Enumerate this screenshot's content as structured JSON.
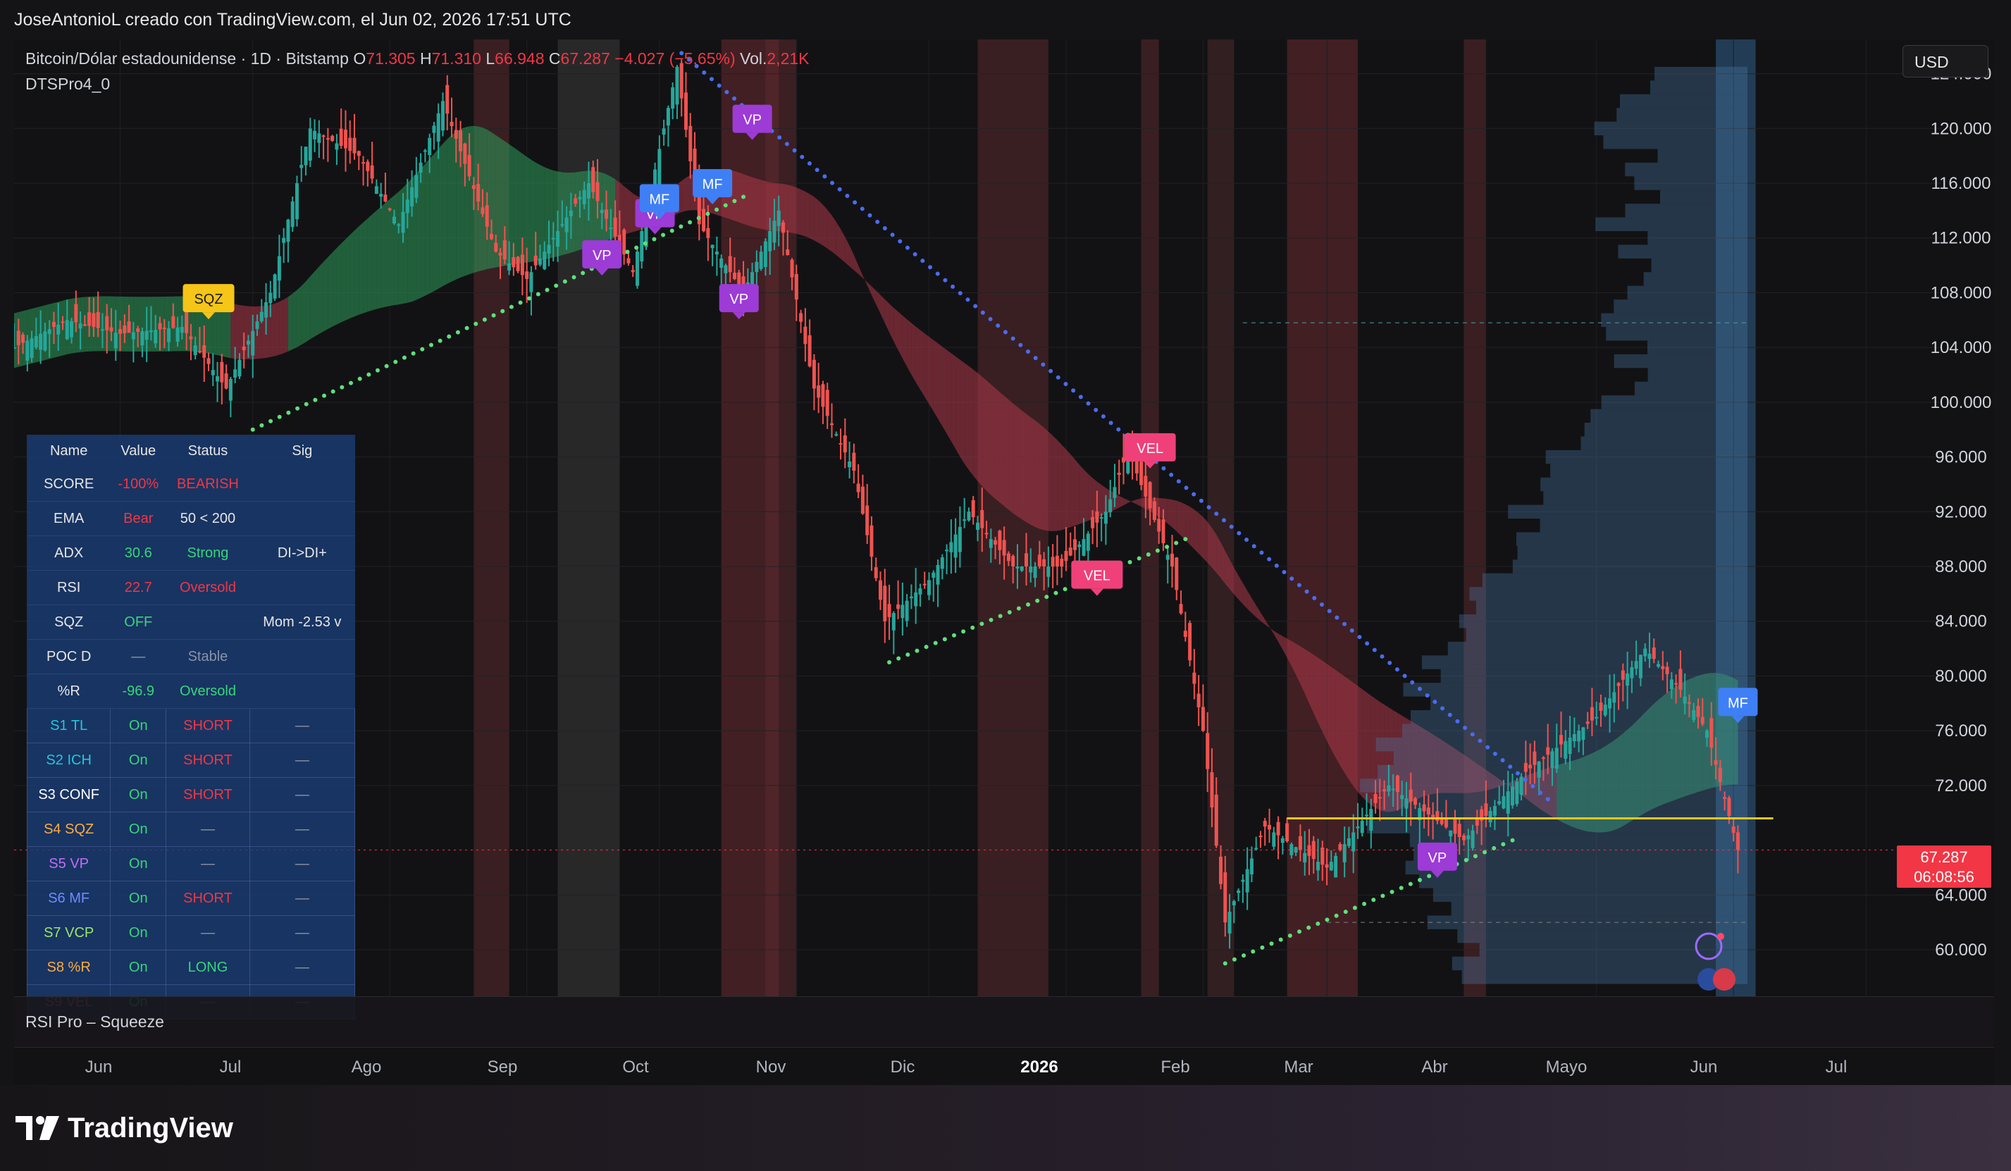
{
  "header": {
    "caption": "JoseAntonioL creado con TradingView.com, el Jun 02, 2026 17:51 UTC"
  },
  "legend": {
    "symbol": "Bitcoin/Dólar estadounidense · 1D · Bitstamp",
    "o_label": "O",
    "o_value": "71.305",
    "h_label": "H",
    "h_value": "71.310",
    "l_label": "L",
    "l_value": "66.948",
    "c_label": "C",
    "c_value": "67.287",
    "change": "−4.027 (−5,65%)",
    "vol_label": "Vol.",
    "vol_value": "2,21K",
    "indicator": "DTSPro4_0"
  },
  "currency_button": "USD",
  "price_tag": {
    "price": "67.287",
    "countdown": "06:08:56"
  },
  "rsi_pane": {
    "label": "RSI Pro – Squeeze"
  },
  "colors": {
    "bull": "#26a69a",
    "bear": "#ef5350",
    "background": "#121214",
    "cloud_bull": "#2e9e5b",
    "cloud_bear": "#b0384a",
    "vp": "#9c3bd6",
    "mf": "#3f7ff5",
    "vel": "#f0407a",
    "sqz": "#f5c518"
  },
  "brand": {
    "name": "TradingView"
  },
  "signal_table": {
    "headers": [
      "Name",
      "Value",
      "Status",
      "Sig"
    ],
    "rows": [
      {
        "name": "SCORE",
        "value": "-100%",
        "status": "BEARISH",
        "sig": ""
      },
      {
        "name": "EMA",
        "value": "Bear",
        "status": "50 < 200",
        "sig": ""
      },
      {
        "name": "ADX",
        "value": "30.6",
        "status": "Strong",
        "sig": "DI->DI+"
      },
      {
        "name": "RSI",
        "value": "22.7",
        "status": "Oversold",
        "sig": ""
      },
      {
        "name": "SQZ",
        "value": "OFF",
        "status": "",
        "sig": "Mom -2.53 v"
      },
      {
        "name": "POC D",
        "value": "—",
        "status": "Stable",
        "sig": ""
      },
      {
        "name": "%R",
        "value": "-96.9",
        "status": "Oversold",
        "sig": ""
      }
    ],
    "strategies": [
      {
        "name": "S1 TL",
        "value": "On",
        "status": "SHORT",
        "sig": "—"
      },
      {
        "name": "S2 ICH",
        "value": "On",
        "status": "SHORT",
        "sig": "—"
      },
      {
        "name": "S3 CONF",
        "value": "On",
        "status": "SHORT",
        "sig": "—"
      },
      {
        "name": "S4 SQZ",
        "value": "On",
        "status": "—",
        "sig": "—"
      },
      {
        "name": "S5 VP",
        "value": "On",
        "status": "—",
        "sig": "—"
      },
      {
        "name": "S6 MF",
        "value": "On",
        "status": "SHORT",
        "sig": "—"
      },
      {
        "name": "S7 VCP",
        "value": "On",
        "status": "—",
        "sig": "—"
      },
      {
        "name": "S8 %R",
        "value": "On",
        "status": "LONG",
        "sig": "—"
      },
      {
        "name": "S9 VEL",
        "value": "On",
        "status": "—",
        "sig": "—"
      }
    ]
  },
  "chart_data": {
    "type": "candlestick",
    "title": "Bitcoin/Dólar estadounidense · 1D · Bitstamp",
    "y_ticks": [
      "124.000",
      "120.000",
      "116.000",
      "112.000",
      "108.000",
      "104.000",
      "100.000",
      "96.000",
      "92.000",
      "88.000",
      "84.000",
      "80.000",
      "76.000",
      "72.000",
      "64.000",
      "60.000"
    ],
    "y_tick_values": [
      124000,
      120000,
      116000,
      112000,
      108000,
      104000,
      100000,
      96000,
      92000,
      88000,
      84000,
      80000,
      76000,
      72000,
      64000,
      60000
    ],
    "ylim": [
      56500,
      126500
    ],
    "x_ticks": [
      {
        "label": "Jun",
        "date": "2025-06-01"
      },
      {
        "label": "Jul",
        "date": "2025-07-01"
      },
      {
        "label": "Ago",
        "date": "2025-08-01"
      },
      {
        "label": "Sep",
        "date": "2025-09-01"
      },
      {
        "label": "Oct",
        "date": "2025-10-01"
      },
      {
        "label": "Nov",
        "date": "2025-11-01"
      },
      {
        "label": "Dic",
        "date": "2025-12-01"
      },
      {
        "label": "2026",
        "date": "2026-01-01"
      },
      {
        "label": "Feb",
        "date": "2026-02-01"
      },
      {
        "label": "Mar",
        "date": "2026-03-01"
      },
      {
        "label": "Abr",
        "date": "2026-04-01"
      },
      {
        "label": "Mayo",
        "date": "2026-05-01"
      },
      {
        "label": "Jun",
        "date": "2026-06-01"
      },
      {
        "label": "Jul",
        "date": "2026-07-01"
      }
    ],
    "xlim": [
      "2025-05-08",
      "2026-07-18"
    ],
    "close_series": [
      [
        "2025-05-08",
        104000
      ],
      [
        "2025-05-20",
        106000
      ],
      [
        "2025-06-01",
        105000
      ],
      [
        "2025-06-15",
        105500
      ],
      [
        "2025-06-25",
        101000
      ],
      [
        "2025-07-05",
        108000
      ],
      [
        "2025-07-14",
        120000
      ],
      [
        "2025-07-25",
        118000
      ],
      [
        "2025-08-03",
        113000
      ],
      [
        "2025-08-13",
        122000
      ],
      [
        "2025-08-25",
        111000
      ],
      [
        "2025-09-01",
        109000
      ],
      [
        "2025-09-15",
        116000
      ],
      [
        "2025-09-25",
        109500
      ],
      [
        "2025-10-05",
        124500
      ],
      [
        "2025-10-10",
        113000
      ],
      [
        "2025-10-20",
        108000
      ],
      [
        "2025-10-28",
        114000
      ],
      [
        "2025-11-05",
        101000
      ],
      [
        "2025-11-14",
        95000
      ],
      [
        "2025-11-21",
        84000
      ],
      [
        "2025-12-01",
        87000
      ],
      [
        "2025-12-10",
        92000
      ],
      [
        "2025-12-20",
        88000
      ],
      [
        "2025-12-31",
        88000
      ],
      [
        "2026-01-10",
        92000
      ],
      [
        "2026-01-15",
        96500
      ],
      [
        "2026-01-25",
        88000
      ],
      [
        "2026-02-01",
        76000
      ],
      [
        "2026-02-06",
        62000
      ],
      [
        "2026-02-15",
        69000
      ],
      [
        "2026-03-01",
        66000
      ],
      [
        "2026-03-15",
        72000
      ],
      [
        "2026-04-01",
        68000
      ],
      [
        "2026-04-15",
        73000
      ],
      [
        "2026-05-01",
        77000
      ],
      [
        "2026-05-12",
        82000
      ],
      [
        "2026-05-20",
        79000
      ],
      [
        "2026-05-26",
        76000
      ],
      [
        "2026-06-02",
        67287
      ]
    ],
    "current_price": 67287,
    "signals": [
      {
        "label": "SQZ",
        "date": "2025-06-21",
        "price": 107500
      },
      {
        "label": "VP",
        "date": "2025-09-18",
        "price": 110700
      },
      {
        "label": "VP",
        "date": "2025-09-30",
        "price": 113700
      },
      {
        "label": "MF",
        "date": "2025-10-01",
        "price": 114800
      },
      {
        "label": "MF",
        "date": "2025-10-13",
        "price": 115900
      },
      {
        "label": "VP",
        "date": "2025-10-22",
        "price": 120600
      },
      {
        "label": "VP",
        "date": "2025-10-19",
        "price": 107500
      },
      {
        "label": "VEL",
        "date": "2026-01-20",
        "price": 96600
      },
      {
        "label": "VEL",
        "date": "2026-01-08",
        "price": 87300
      },
      {
        "label": "VP",
        "date": "2026-03-26",
        "price": 66700
      },
      {
        "label": "MF",
        "date": "2026-06-02",
        "price": 78000
      }
    ],
    "grid": true
  }
}
